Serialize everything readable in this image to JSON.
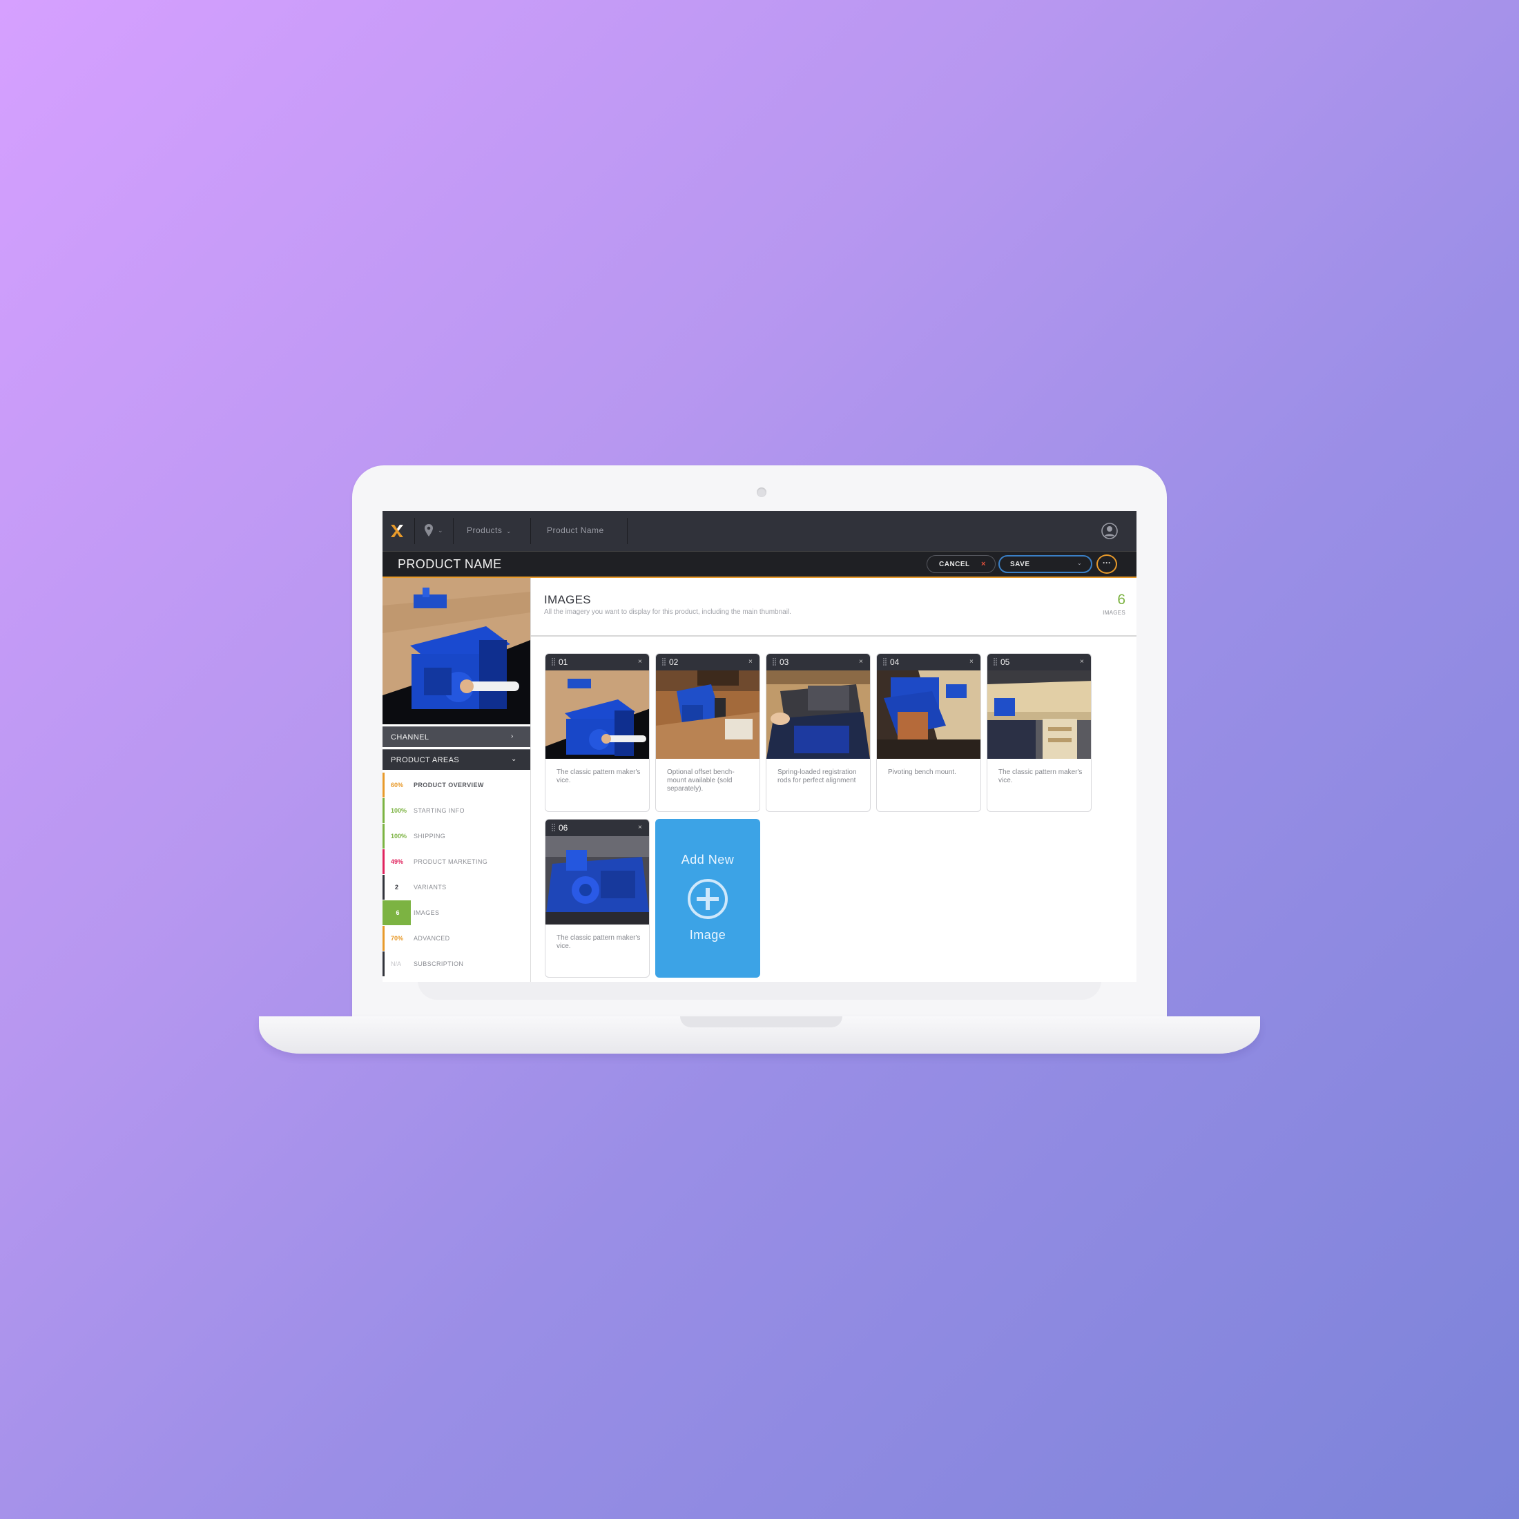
{
  "topbar": {
    "breadcrumbs": [
      "Products",
      "Product Name"
    ]
  },
  "header": {
    "title": "PRODUCT NAME",
    "cancel_label": "CANCEL",
    "save_label": "SAVE",
    "more_label": "···"
  },
  "sidebar": {
    "channel_label": "CHANNEL",
    "product_areas_label": "PRODUCT AREAS",
    "areas": [
      {
        "value": "60%",
        "label": "PRODUCT OVERVIEW",
        "color": "#e89a2a"
      },
      {
        "value": "100%",
        "label": "STARTING INFO",
        "color": "#7cb342"
      },
      {
        "value": "100%",
        "label": "SHIPPING",
        "color": "#7cb342"
      },
      {
        "value": "49%",
        "label": "PRODUCT MARKETING",
        "color": "#e0245e"
      },
      {
        "value": "2",
        "label": "VARIANTS",
        "color": "#32343b"
      },
      {
        "value": "6",
        "label": "IMAGES",
        "color": "#7cb342"
      },
      {
        "value": "70%",
        "label": "ADVANCED",
        "color": "#e89a2a"
      },
      {
        "value": "N/A",
        "label": "SUBSCRIPTION",
        "color": "#c5c5c9"
      }
    ]
  },
  "main": {
    "title": "IMAGES",
    "subtitle": "All the imagery you want to display for this product, including the main thumbnail.",
    "count": "6",
    "count_label": "IMAGES",
    "close_symbol": "×",
    "cards": [
      {
        "number": "01",
        "caption": "The classic pattern maker's vice."
      },
      {
        "number": "02",
        "caption": "Optional offset bench-mount available (sold separately)."
      },
      {
        "number": "03",
        "caption": "Spring-loaded registration rods for perfect alignment"
      },
      {
        "number": "04",
        "caption": "Pivoting bench mount."
      },
      {
        "number": "05",
        "caption": "The classic pattern maker's vice."
      },
      {
        "number": "06",
        "caption": "The classic pattern maker's vice."
      }
    ],
    "add_new": {
      "line1": "Add New",
      "line2": "Image"
    }
  },
  "colors": {
    "accent": "#e89a2a",
    "save_border": "#3a7fc5",
    "success": "#7cb342",
    "add_card": "#3ca3e6"
  }
}
